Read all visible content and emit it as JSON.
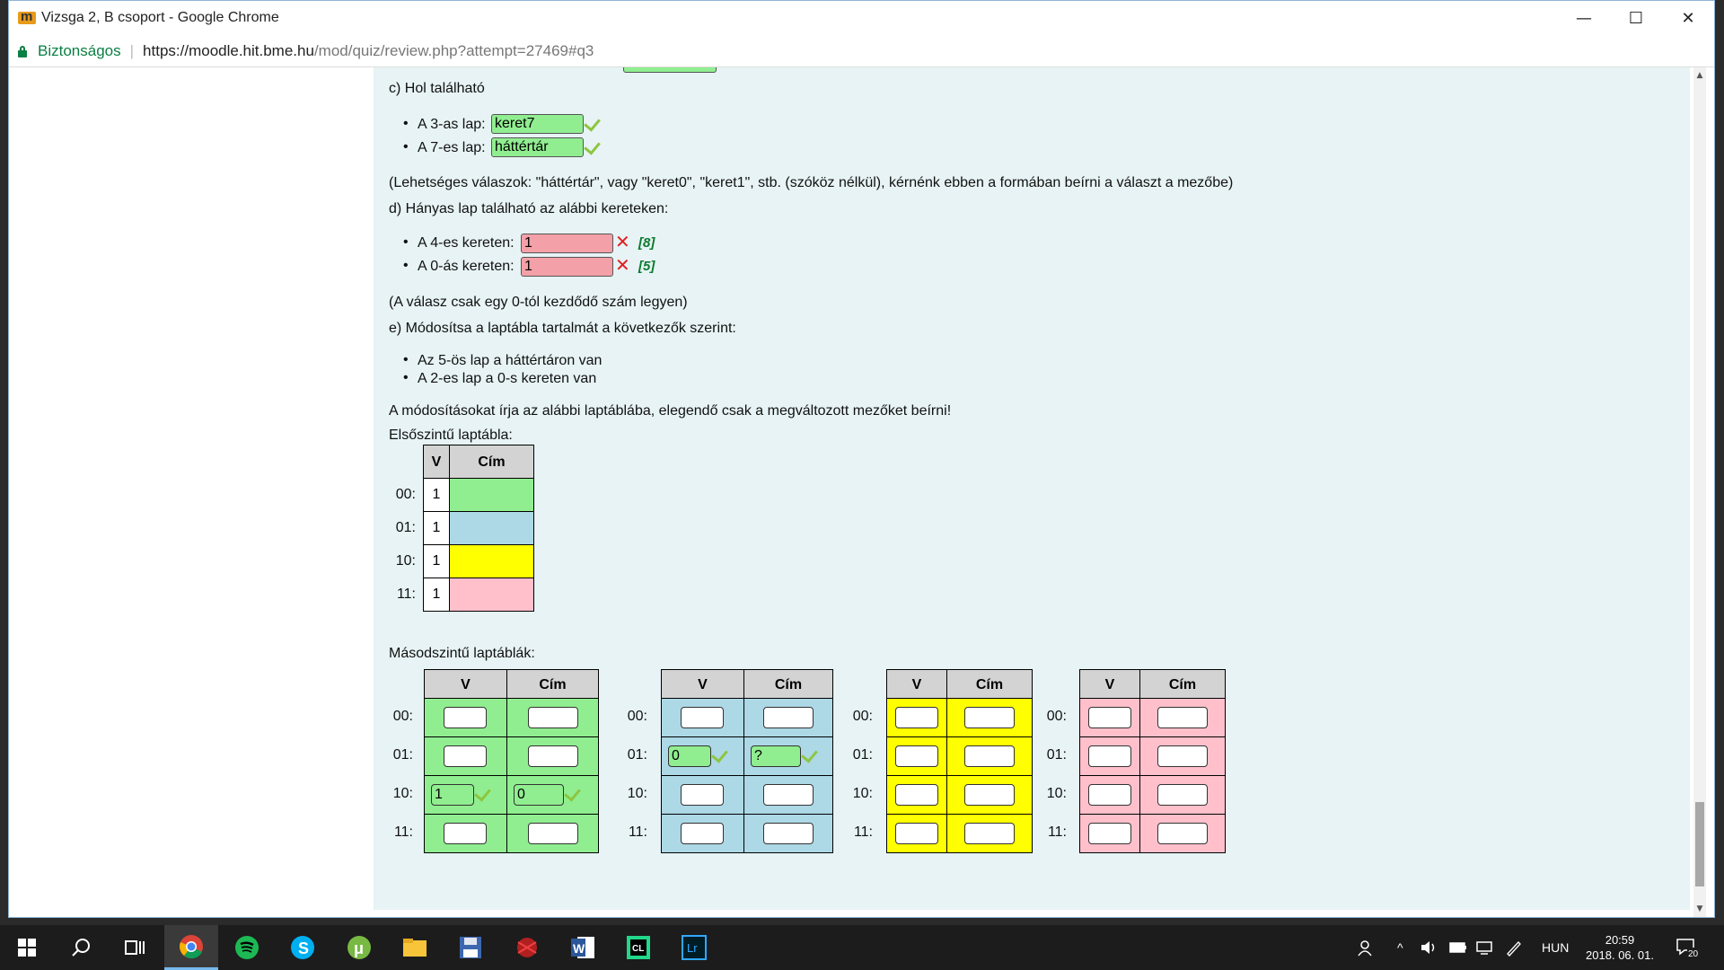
{
  "window": {
    "title": "Vizsga 2, B csoport - Google Chrome",
    "minimize": "—",
    "maximize": "☐",
    "close": "✕"
  },
  "address": {
    "secure_label": "Biztonságos",
    "url_host": "https://moodle.hit.bme.hu",
    "url_path": "/mod/quiz/review.php?attempt=27469#q3"
  },
  "quiz": {
    "c_title": "c) Hol található",
    "c_items": [
      {
        "label": "A 3-as lap:",
        "answer": "keret7"
      },
      {
        "label": "A 7-es lap:",
        "answer": "háttértár"
      }
    ],
    "c_note": "(Lehetséges válaszok: \"háttértár\", vagy \"keret0\", \"keret1\", stb. (szóköz nélkül), kérnénk ebben a formában beírni a választ a mezőbe)",
    "d_title": "d) Hányas lap található az alábbi kereteken:",
    "d_items": [
      {
        "label": "A 4-es kereten:",
        "answer": "1",
        "correct": "[8]"
      },
      {
        "label": "A 0-ás kereten:",
        "answer": "1",
        "correct": "[5]"
      }
    ],
    "d_note": "(A válasz csak egy 0-tól kezdődő szám legyen)",
    "e_title": "e) Módosítsa a laptábla tartalmát a következők szerint:",
    "e_items": [
      "Az 5-ös lap a háttértáron van",
      "A 2-es lap a 0-s kereten van"
    ],
    "e_instruction": "A módosításokat írja az alábbi laptáblába, elegendő csak a megváltozott mezőket beírni!",
    "first_level_title": "Elsőszintű laptábla:",
    "table_headers": {
      "v": "V",
      "cim": "Cím"
    },
    "first_level_rows": [
      {
        "label": "00:",
        "v": "1",
        "color": "#90ee90"
      },
      {
        "label": "01:",
        "v": "1",
        "color": "#add8e6"
      },
      {
        "label": "10:",
        "v": "1",
        "color": "#ffff00"
      },
      {
        "label": "11:",
        "v": "1",
        "color": "#ffc0cb"
      }
    ],
    "second_level_title": "Másodszintű laptáblák:",
    "row_labels": [
      "00:",
      "01:",
      "10:",
      "11:"
    ],
    "green_table": {
      "r10_v": "1",
      "r10_cim": "0"
    },
    "blue_table": {
      "r01_v": "0",
      "r01_cim": "?"
    }
  },
  "taskbar": {
    "apps": [
      "start-icon",
      "search-icon",
      "task-view-icon",
      "chrome-icon",
      "spotify-icon",
      "skype-icon",
      "utorrent-icon",
      "file-explorer-icon",
      "save-icon",
      "game-icon",
      "word-icon",
      "clion-icon",
      "lightroom-icon"
    ],
    "lang": "HUN",
    "time": "20:59",
    "date": "2018. 06. 01.",
    "notifications": "20"
  }
}
